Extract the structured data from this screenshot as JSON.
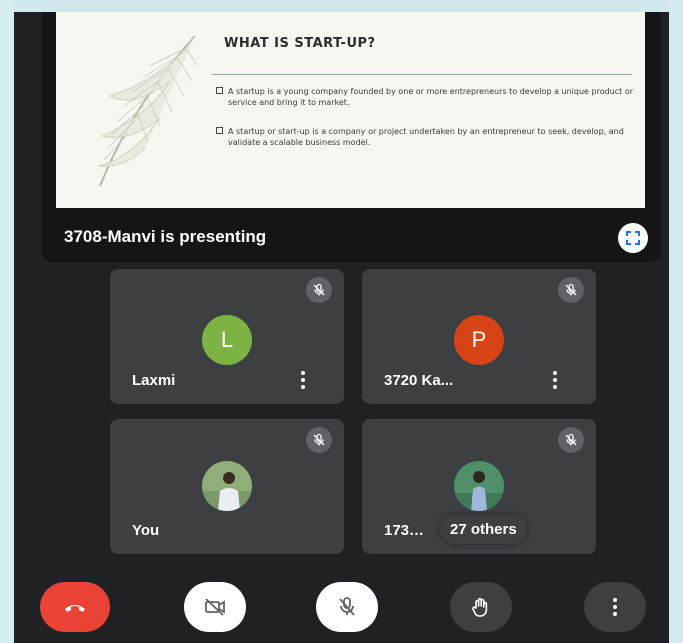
{
  "slide": {
    "title": "WHAT IS START-UP?",
    "bullets": [
      "A startup is a young company founded by one or more entrepreneurs to develop a unique product or service and bring it to market.",
      "A startup or start-up is a company or project undertaken by an entrepreneur to seek, develop, and validate a scalable business model."
    ]
  },
  "presenter": {
    "label": "3708-Manvi is presenting",
    "fullscreen_icon": "fullscreen-icon"
  },
  "participants": [
    {
      "name": "Laxmi",
      "initial": "L",
      "avatar_color": "#7cb342",
      "muted": true
    },
    {
      "name": "3720 Ka...",
      "initial": "P",
      "avatar_color": "#d84315",
      "muted": true
    },
    {
      "name": "You",
      "avatar": "photo",
      "muted": true
    },
    {
      "name": "173…",
      "avatar": "photo",
      "muted": true,
      "overlay": "27 others"
    }
  ],
  "controls": [
    {
      "name": "end-call",
      "icon": "phone-hangup-icon",
      "color": "#ea4335"
    },
    {
      "name": "camera-off",
      "icon": "video-off-icon",
      "color": "#ffffff"
    },
    {
      "name": "mic-off",
      "icon": "mic-off-icon",
      "color": "#ffffff"
    },
    {
      "name": "raise-hand",
      "icon": "hand-icon",
      "color": "#3c4043"
    },
    {
      "name": "more-options",
      "icon": "more-vert-icon",
      "color": "#3c4043"
    }
  ]
}
